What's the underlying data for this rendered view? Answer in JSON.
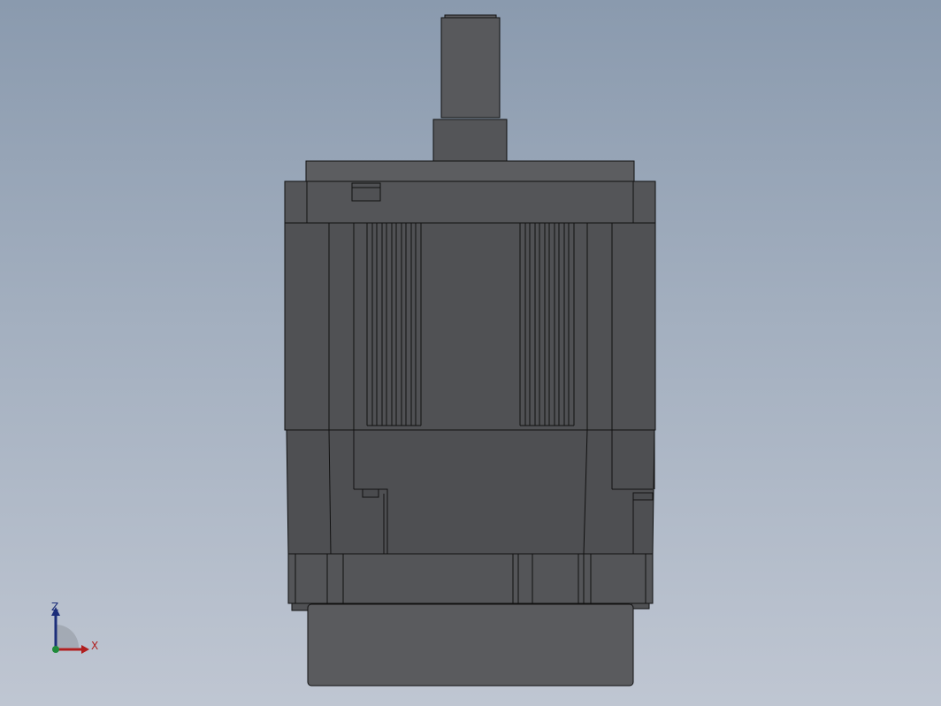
{
  "viewport": {
    "background_top": "#8a9aae",
    "background_bottom": "#bfc6d2",
    "model_color": "#525356",
    "edge_color": "#111111"
  },
  "triad": {
    "z_label": "Z",
    "x_label": "X",
    "z_color": "#1c2e7a",
    "x_color": "#b01e1e",
    "origin_color": "#1f8a3a"
  }
}
